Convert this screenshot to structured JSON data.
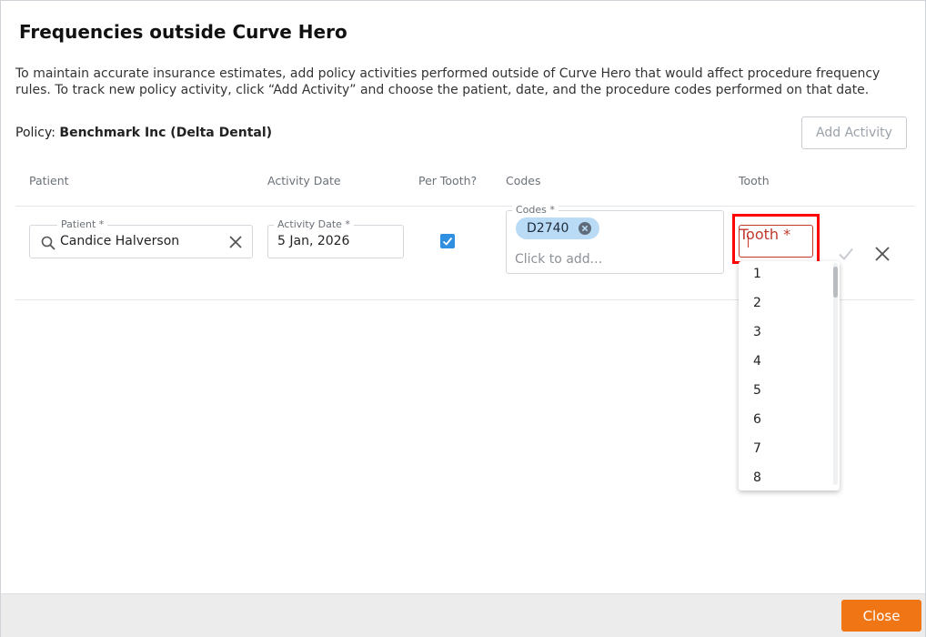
{
  "dialog": {
    "title": "Frequencies outside Curve Hero",
    "description": "To maintain accurate insurance estimates, add policy activities performed outside of Curve Hero that would affect procedure frequency rules. To track new policy activity, click “Add Activity” and choose the patient, date, and the procedure codes performed on that date.",
    "policy_label": "Policy:",
    "policy_value": "Benchmark Inc (Delta Dental)",
    "add_activity_label": "Add Activity",
    "close_label": "Close"
  },
  "table": {
    "headers": {
      "patient": "Patient",
      "activity_date": "Activity Date",
      "per_tooth": "Per Tooth?",
      "codes": "Codes",
      "tooth": "Tooth"
    }
  },
  "row": {
    "patient_label": "Patient *",
    "patient_value": "Candice Halverson",
    "date_label": "Activity Date *",
    "date_value": "5 Jan, 2026",
    "per_tooth_checked": true,
    "codes_label": "Codes *",
    "code_chips": [
      "D2740"
    ],
    "codes_placeholder": "Click to add...",
    "tooth_label": "Tooth *",
    "tooth_value": ""
  },
  "tooth_options": [
    "1",
    "2",
    "3",
    "4",
    "5",
    "6",
    "7",
    "8"
  ],
  "colors": {
    "accent_orange": "#f07515",
    "chip_blue": "#b9dbf5",
    "checkbox_blue": "#2f8fe0",
    "highlight_red": "#ff0000"
  }
}
